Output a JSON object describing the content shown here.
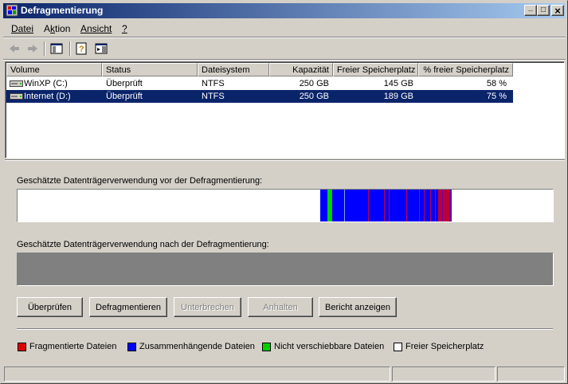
{
  "window": {
    "title": "Defragmentierung"
  },
  "titlebar_buttons": {
    "minimize": "_",
    "maximize": "□",
    "close": "×"
  },
  "menu": {
    "items": [
      {
        "label": "Datei",
        "underline_index": 0
      },
      {
        "label": "Aktion",
        "underline_index": 1
      },
      {
        "label": "Ansicht",
        "underline_index": 0
      },
      {
        "label": "?",
        "underline_index": 0
      }
    ]
  },
  "toolbar": {
    "icons": [
      "back-icon",
      "forward-icon",
      "console-tree-icon",
      "help-icon",
      "action-pane-icon"
    ]
  },
  "volumes": {
    "columns": [
      "Volume",
      "Status",
      "Dateisystem",
      "Kapazität",
      "Freier Speicherplatz",
      "% freier Speicherplatz"
    ],
    "rows": [
      {
        "volume": "WinXP (C:)",
        "status": "Überprüft",
        "filesystem": "NTFS",
        "capacity": "250 GB",
        "free": "145 GB",
        "free_pct": "58 %",
        "selected": false
      },
      {
        "volume": "Internet (D:)",
        "status": "Überprüft",
        "filesystem": "NTFS",
        "capacity": "250 GB",
        "free": "189 GB",
        "free_pct": "75 %",
        "selected": true
      }
    ]
  },
  "analysis": {
    "before_label": "Geschätzte Datenträgerverwendung vor der Defragmentierung:",
    "after_label": "Geschätzte Datenträgerverwendung nach der Defragmentierung:"
  },
  "buttons": {
    "analyze": "Überprüfen",
    "defragment": "Defragmentieren",
    "pause": "Unterbrechen",
    "stop": "Anhalten",
    "view_report": "Bericht anzeigen"
  },
  "legend": {
    "fragmented": "Fragmentierte Dateien",
    "contiguous": "Zusammenhängende Dateien",
    "unmovable": "Nicht verschiebbare Dateien",
    "free": "Freier Speicherplatz"
  },
  "colors": {
    "fragmented": "#e00000",
    "contiguous": "#0000ff",
    "unmovable": "#00d000",
    "free": "#ffffff",
    "selection": "#0a246a",
    "titlebar_start": "#0a246a",
    "titlebar_end": "#a6caf0"
  }
}
